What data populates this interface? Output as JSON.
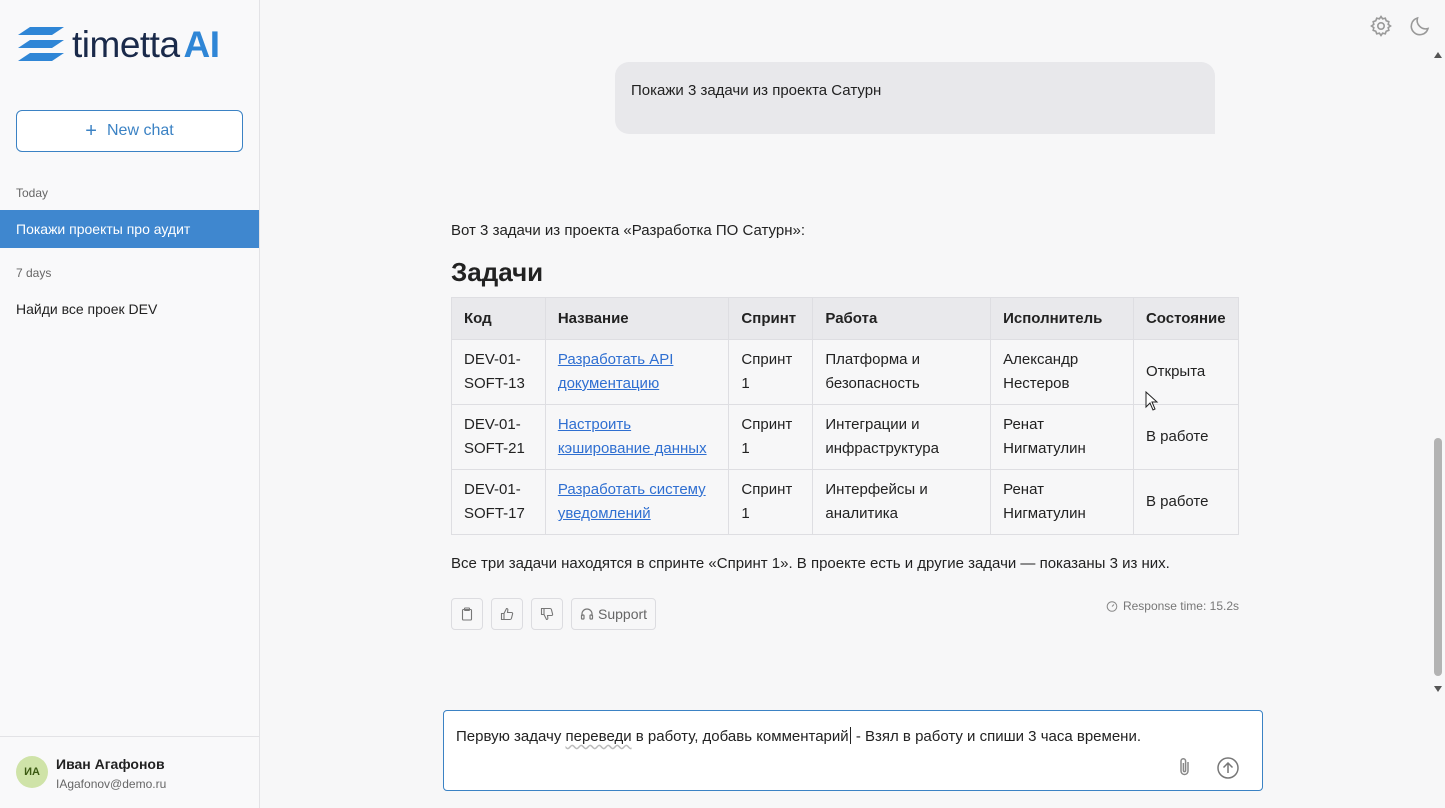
{
  "brand": {
    "name": "timetta",
    "suffix": "AI",
    "accent": "#2f86d6"
  },
  "sidebar": {
    "new_chat_label": "New chat",
    "sections": [
      {
        "label": "Today",
        "items": [
          {
            "label": "Покажи проекты про аудит",
            "active": true
          }
        ]
      },
      {
        "label": "7 days",
        "items": [
          {
            "label": "Найди все проек DEV",
            "active": false
          }
        ]
      }
    ],
    "user": {
      "initials": "ИА",
      "name": "Иван Агафонов",
      "email": "IAgafonov@demo.ru"
    }
  },
  "header": {
    "icons": [
      "gear-icon",
      "moon-icon"
    ]
  },
  "conversation": {
    "user_message": "Покажи 3 задачи из проекта Сатурн",
    "assistant": {
      "intro": "Вот 3 задачи из проекта «Разработка ПО Сатурн»:",
      "heading": "Задачи",
      "table": {
        "columns": [
          "Код",
          "Название",
          "Спринт",
          "Работа",
          "Исполнитель",
          "Состояние"
        ],
        "rows": [
          {
            "code": "DEV-01-SOFT-13",
            "name": "Разработать API документацию",
            "sprint": "Спринт 1",
            "work": "Платформа и безопасность",
            "assignee": "Александр Нестеров",
            "status": "Открыта"
          },
          {
            "code": "DEV-01-SOFT-21",
            "name": "Настроить кэширование данных",
            "sprint": "Спринт 1",
            "work": "Интеграции и инфраструктура",
            "assignee": "Ренат Нигматулин",
            "status": "В работе"
          },
          {
            "code": "DEV-01-SOFT-17",
            "name": "Разработать систему уведомлений",
            "sprint": "Спринт 1",
            "work": "Интерфейсы и аналитика",
            "assignee": "Ренат Нигматулин",
            "status": "В работе"
          }
        ]
      },
      "summary": "Все три задачи находятся в спринте «Спринт 1». В проекте есть и другие задачи — показаны 3 из них.",
      "support_label": "Support",
      "response_time": "Response time: 15.2s"
    }
  },
  "composer": {
    "text_before": "Первую задачу ",
    "text_squiggle": "переведи",
    "text_mid": " в работу, добавь комментарий",
    "text_after": " - Взял в работу и спиши 3 часа времени."
  }
}
